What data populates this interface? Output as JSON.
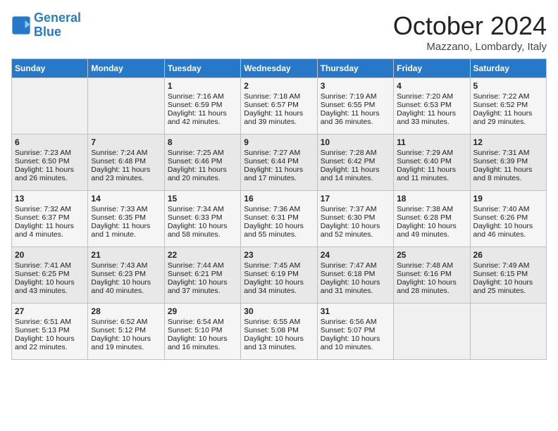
{
  "logo": {
    "line1": "General",
    "line2": "Blue"
  },
  "title": "October 2024",
  "subtitle": "Mazzano, Lombardy, Italy",
  "days_of_week": [
    "Sunday",
    "Monday",
    "Tuesday",
    "Wednesday",
    "Thursday",
    "Friday",
    "Saturday"
  ],
  "weeks": [
    [
      {
        "day": "",
        "sunrise": "",
        "sunset": "",
        "daylight": ""
      },
      {
        "day": "",
        "sunrise": "",
        "sunset": "",
        "daylight": ""
      },
      {
        "day": "1",
        "sunrise": "Sunrise: 7:16 AM",
        "sunset": "Sunset: 6:59 PM",
        "daylight": "Daylight: 11 hours and 42 minutes."
      },
      {
        "day": "2",
        "sunrise": "Sunrise: 7:18 AM",
        "sunset": "Sunset: 6:57 PM",
        "daylight": "Daylight: 11 hours and 39 minutes."
      },
      {
        "day": "3",
        "sunrise": "Sunrise: 7:19 AM",
        "sunset": "Sunset: 6:55 PM",
        "daylight": "Daylight: 11 hours and 36 minutes."
      },
      {
        "day": "4",
        "sunrise": "Sunrise: 7:20 AM",
        "sunset": "Sunset: 6:53 PM",
        "daylight": "Daylight: 11 hours and 33 minutes."
      },
      {
        "day": "5",
        "sunrise": "Sunrise: 7:22 AM",
        "sunset": "Sunset: 6:52 PM",
        "daylight": "Daylight: 11 hours and 29 minutes."
      }
    ],
    [
      {
        "day": "6",
        "sunrise": "Sunrise: 7:23 AM",
        "sunset": "Sunset: 6:50 PM",
        "daylight": "Daylight: 11 hours and 26 minutes."
      },
      {
        "day": "7",
        "sunrise": "Sunrise: 7:24 AM",
        "sunset": "Sunset: 6:48 PM",
        "daylight": "Daylight: 11 hours and 23 minutes."
      },
      {
        "day": "8",
        "sunrise": "Sunrise: 7:25 AM",
        "sunset": "Sunset: 6:46 PM",
        "daylight": "Daylight: 11 hours and 20 minutes."
      },
      {
        "day": "9",
        "sunrise": "Sunrise: 7:27 AM",
        "sunset": "Sunset: 6:44 PM",
        "daylight": "Daylight: 11 hours and 17 minutes."
      },
      {
        "day": "10",
        "sunrise": "Sunrise: 7:28 AM",
        "sunset": "Sunset: 6:42 PM",
        "daylight": "Daylight: 11 hours and 14 minutes."
      },
      {
        "day": "11",
        "sunrise": "Sunrise: 7:29 AM",
        "sunset": "Sunset: 6:40 PM",
        "daylight": "Daylight: 11 hours and 11 minutes."
      },
      {
        "day": "12",
        "sunrise": "Sunrise: 7:31 AM",
        "sunset": "Sunset: 6:39 PM",
        "daylight": "Daylight: 11 hours and 8 minutes."
      }
    ],
    [
      {
        "day": "13",
        "sunrise": "Sunrise: 7:32 AM",
        "sunset": "Sunset: 6:37 PM",
        "daylight": "Daylight: 11 hours and 4 minutes."
      },
      {
        "day": "14",
        "sunrise": "Sunrise: 7:33 AM",
        "sunset": "Sunset: 6:35 PM",
        "daylight": "Daylight: 11 hours and 1 minute."
      },
      {
        "day": "15",
        "sunrise": "Sunrise: 7:34 AM",
        "sunset": "Sunset: 6:33 PM",
        "daylight": "Daylight: 10 hours and 58 minutes."
      },
      {
        "day": "16",
        "sunrise": "Sunrise: 7:36 AM",
        "sunset": "Sunset: 6:31 PM",
        "daylight": "Daylight: 10 hours and 55 minutes."
      },
      {
        "day": "17",
        "sunrise": "Sunrise: 7:37 AM",
        "sunset": "Sunset: 6:30 PM",
        "daylight": "Daylight: 10 hours and 52 minutes."
      },
      {
        "day": "18",
        "sunrise": "Sunrise: 7:38 AM",
        "sunset": "Sunset: 6:28 PM",
        "daylight": "Daylight: 10 hours and 49 minutes."
      },
      {
        "day": "19",
        "sunrise": "Sunrise: 7:40 AM",
        "sunset": "Sunset: 6:26 PM",
        "daylight": "Daylight: 10 hours and 46 minutes."
      }
    ],
    [
      {
        "day": "20",
        "sunrise": "Sunrise: 7:41 AM",
        "sunset": "Sunset: 6:25 PM",
        "daylight": "Daylight: 10 hours and 43 minutes."
      },
      {
        "day": "21",
        "sunrise": "Sunrise: 7:43 AM",
        "sunset": "Sunset: 6:23 PM",
        "daylight": "Daylight: 10 hours and 40 minutes."
      },
      {
        "day": "22",
        "sunrise": "Sunrise: 7:44 AM",
        "sunset": "Sunset: 6:21 PM",
        "daylight": "Daylight: 10 hours and 37 minutes."
      },
      {
        "day": "23",
        "sunrise": "Sunrise: 7:45 AM",
        "sunset": "Sunset: 6:19 PM",
        "daylight": "Daylight: 10 hours and 34 minutes."
      },
      {
        "day": "24",
        "sunrise": "Sunrise: 7:47 AM",
        "sunset": "Sunset: 6:18 PM",
        "daylight": "Daylight: 10 hours and 31 minutes."
      },
      {
        "day": "25",
        "sunrise": "Sunrise: 7:48 AM",
        "sunset": "Sunset: 6:16 PM",
        "daylight": "Daylight: 10 hours and 28 minutes."
      },
      {
        "day": "26",
        "sunrise": "Sunrise: 7:49 AM",
        "sunset": "Sunset: 6:15 PM",
        "daylight": "Daylight: 10 hours and 25 minutes."
      }
    ],
    [
      {
        "day": "27",
        "sunrise": "Sunrise: 6:51 AM",
        "sunset": "Sunset: 5:13 PM",
        "daylight": "Daylight: 10 hours and 22 minutes."
      },
      {
        "day": "28",
        "sunrise": "Sunrise: 6:52 AM",
        "sunset": "Sunset: 5:12 PM",
        "daylight": "Daylight: 10 hours and 19 minutes."
      },
      {
        "day": "29",
        "sunrise": "Sunrise: 6:54 AM",
        "sunset": "Sunset: 5:10 PM",
        "daylight": "Daylight: 10 hours and 16 minutes."
      },
      {
        "day": "30",
        "sunrise": "Sunrise: 6:55 AM",
        "sunset": "Sunset: 5:08 PM",
        "daylight": "Daylight: 10 hours and 13 minutes."
      },
      {
        "day": "31",
        "sunrise": "Sunrise: 6:56 AM",
        "sunset": "Sunset: 5:07 PM",
        "daylight": "Daylight: 10 hours and 10 minutes."
      },
      {
        "day": "",
        "sunrise": "",
        "sunset": "",
        "daylight": ""
      },
      {
        "day": "",
        "sunrise": "",
        "sunset": "",
        "daylight": ""
      }
    ]
  ]
}
